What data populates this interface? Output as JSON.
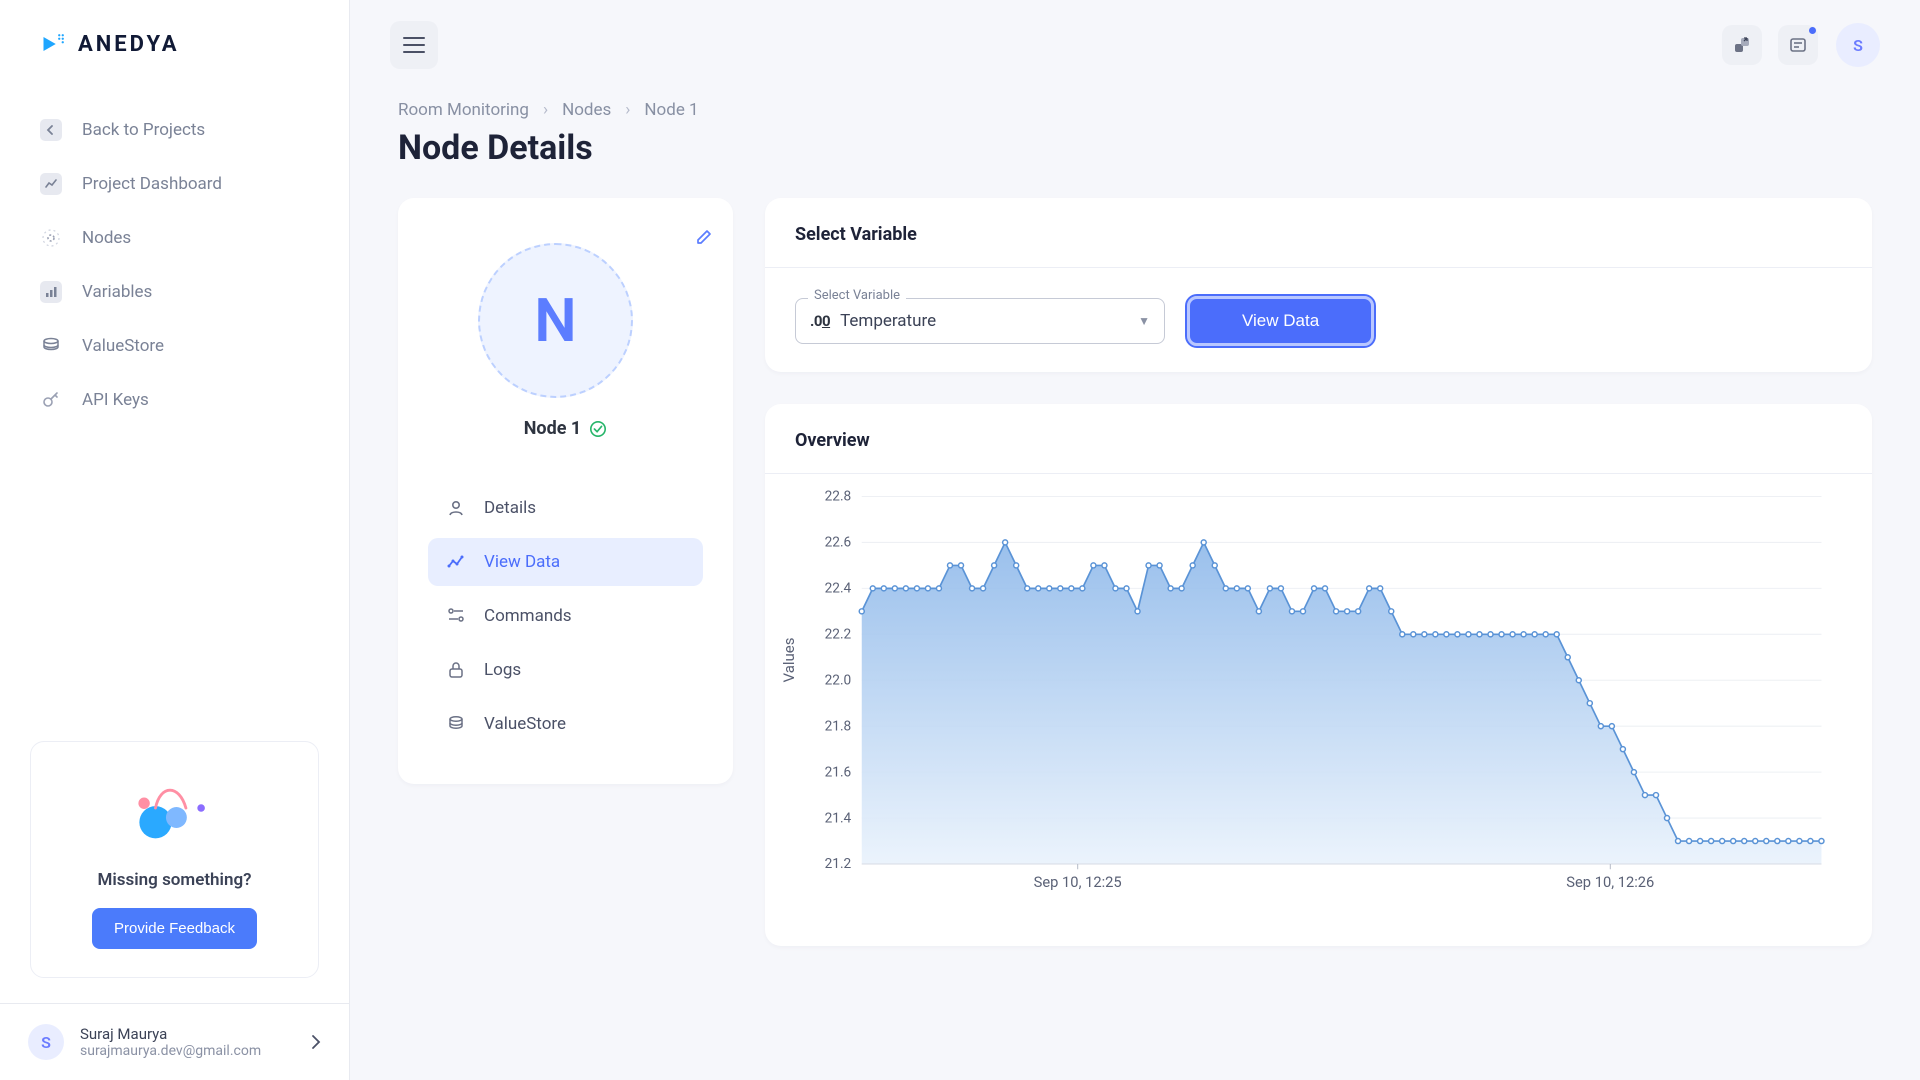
{
  "brand": {
    "name": "ANEDYA"
  },
  "sidebar": {
    "items": [
      {
        "label": "Back to Projects"
      },
      {
        "label": "Project Dashboard"
      },
      {
        "label": "Nodes"
      },
      {
        "label": "Variables"
      },
      {
        "label": "ValueStore"
      },
      {
        "label": "API Keys"
      }
    ],
    "feedback": {
      "title": "Missing something?",
      "button": "Provide Feedback"
    },
    "user": {
      "name": "Suraj Maurya",
      "email": "surajmaurya.dev@gmail.com",
      "initial": "S"
    }
  },
  "topbar": {
    "avatar_initial": "S"
  },
  "breadcrumb": {
    "a": "Room Monitoring",
    "b": "Nodes",
    "c": "Node 1"
  },
  "page": {
    "title": "Node Details"
  },
  "node": {
    "initial": "N",
    "name": "Node 1",
    "tabs": [
      {
        "label": "Details"
      },
      {
        "label": "View Data"
      },
      {
        "label": "Commands"
      },
      {
        "label": "Logs"
      },
      {
        "label": "ValueStore"
      }
    ]
  },
  "select_card": {
    "title": "Select Variable",
    "field_label": "Select Variable",
    "value": "Temperature",
    "button": "View Data"
  },
  "overview": {
    "title": "Overview"
  },
  "chart_data": {
    "type": "area",
    "ylabel": "Values",
    "xlabel": "",
    "ylim": [
      21.2,
      22.8
    ],
    "yticks": [
      21.2,
      21.4,
      21.6,
      21.8,
      22.0,
      22.2,
      22.4,
      22.6,
      22.8
    ],
    "x_ticks_labels": [
      "Sep 10, 12:25",
      "Sep 10, 12:26"
    ],
    "x_tick_positions": [
      0.225,
      0.78
    ],
    "series": [
      {
        "name": "Temperature",
        "values": [
          22.3,
          22.4,
          22.4,
          22.4,
          22.4,
          22.4,
          22.4,
          22.4,
          22.5,
          22.5,
          22.4,
          22.4,
          22.5,
          22.6,
          22.5,
          22.4,
          22.4,
          22.4,
          22.4,
          22.4,
          22.4,
          22.5,
          22.5,
          22.4,
          22.4,
          22.3,
          22.5,
          22.5,
          22.4,
          22.4,
          22.5,
          22.6,
          22.5,
          22.4,
          22.4,
          22.4,
          22.3,
          22.4,
          22.4,
          22.3,
          22.3,
          22.4,
          22.4,
          22.3,
          22.3,
          22.3,
          22.4,
          22.4,
          22.3,
          22.2,
          22.2,
          22.2,
          22.2,
          22.2,
          22.2,
          22.2,
          22.2,
          22.2,
          22.2,
          22.2,
          22.2,
          22.2,
          22.2,
          22.2,
          22.1,
          22.0,
          21.9,
          21.8,
          21.8,
          21.7,
          21.6,
          21.5,
          21.5,
          21.4,
          21.3,
          21.3,
          21.3,
          21.3,
          21.3,
          21.3,
          21.3,
          21.3,
          21.3,
          21.3,
          21.3,
          21.3,
          21.3,
          21.3
        ]
      }
    ]
  }
}
